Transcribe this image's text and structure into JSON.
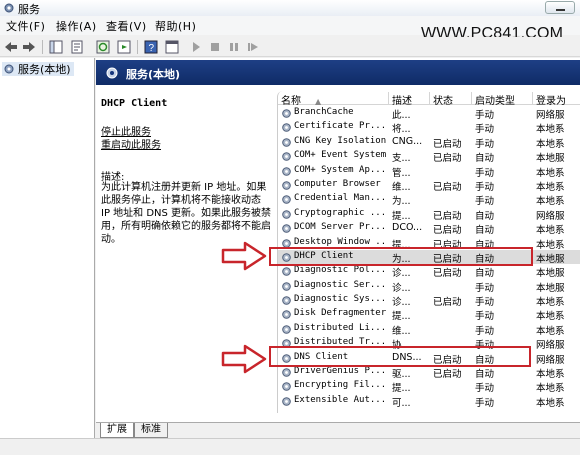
{
  "window": {
    "title": "服务"
  },
  "watermark": "WWW.PC841.COM",
  "menu": [
    {
      "label": "文件(F)"
    },
    {
      "label": "操作(A)"
    },
    {
      "label": "查看(V)"
    },
    {
      "label": "帮助(H)"
    }
  ],
  "toolbar": {
    "icons": [
      "back-icon",
      "forward-icon",
      "show-tree-icon",
      "properties-icon",
      "refresh-icon",
      "export-icon",
      "help-icon",
      "console-icon",
      "start-icon",
      "stop-icon",
      "pause-icon",
      "restart-icon"
    ]
  },
  "tree": {
    "item": "服务(本地)"
  },
  "pane": {
    "title": "服务(本地)"
  },
  "detail": {
    "service_name": "DHCP Client",
    "stop_link": "停止此服务",
    "restart_link": "重启动此服务",
    "desc_label": "描述:",
    "desc_text": "为此计算机注册并更新 IP 地址。如果此服务停止，计算机将不能接收动态 IP 地址和 DNS 更新。如果此服务被禁用，所有明确依赖它的服务都将不能启动。"
  },
  "columns": {
    "name": "名称",
    "desc": "描述",
    "status": "状态",
    "start": "启动类型",
    "logon": "登录为"
  },
  "services": [
    {
      "name": "BranchCache",
      "desc": "此...",
      "status": "",
      "start": "手动",
      "logon": "网络服"
    },
    {
      "name": "Certificate Pr...",
      "desc": "将...",
      "status": "",
      "start": "手动",
      "logon": "本地系"
    },
    {
      "name": "CNG Key Isolation",
      "desc": "CNG...",
      "status": "已启动",
      "start": "手动",
      "logon": "本地系"
    },
    {
      "name": "COM+ Event System",
      "desc": "支...",
      "status": "已启动",
      "start": "自动",
      "logon": "本地服"
    },
    {
      "name": "COM+ System Ap...",
      "desc": "管...",
      "status": "",
      "start": "手动",
      "logon": "本地系"
    },
    {
      "name": "Computer Browser",
      "desc": "维...",
      "status": "已启动",
      "start": "手动",
      "logon": "本地系"
    },
    {
      "name": "Credential Man...",
      "desc": "为...",
      "status": "",
      "start": "手动",
      "logon": "本地系"
    },
    {
      "name": "Cryptographic ...",
      "desc": "提...",
      "status": "已启动",
      "start": "自动",
      "logon": "网络服"
    },
    {
      "name": "DCOM Server Pr...",
      "desc": "DCO...",
      "status": "已启动",
      "start": "自动",
      "logon": "本地系"
    },
    {
      "name": "Desktop Window ...",
      "desc": "提...",
      "status": "已启动",
      "start": "自动",
      "logon": "本地系"
    },
    {
      "name": "DHCP Client",
      "desc": "为...",
      "status": "已启动",
      "start": "自动",
      "logon": "本地服"
    },
    {
      "name": "Diagnostic Pol...",
      "desc": "诊...",
      "status": "已启动",
      "start": "自动",
      "logon": "本地服"
    },
    {
      "name": "Diagnostic Ser...",
      "desc": "诊...",
      "status": "",
      "start": "手动",
      "logon": "本地服"
    },
    {
      "name": "Diagnostic Sys...",
      "desc": "诊...",
      "status": "已启动",
      "start": "手动",
      "logon": "本地系"
    },
    {
      "name": "Disk Defragmenter",
      "desc": "提...",
      "status": "",
      "start": "手动",
      "logon": "本地系"
    },
    {
      "name": "Distributed Li...",
      "desc": "维...",
      "status": "",
      "start": "手动",
      "logon": "本地系"
    },
    {
      "name": "Distributed Tr...",
      "desc": "协...",
      "status": "",
      "start": "手动",
      "logon": "网络服"
    },
    {
      "name": "DNS Client",
      "desc": "DNS...",
      "status": "已启动",
      "start": "自动",
      "logon": "网络服"
    },
    {
      "name": "DriverGenius P...",
      "desc": "驱...",
      "status": "已启动",
      "start": "自动",
      "logon": "本地系"
    },
    {
      "name": "Encrypting Fil...",
      "desc": "提...",
      "status": "",
      "start": "手动",
      "logon": "本地系"
    },
    {
      "name": "Extensible Aut...",
      "desc": "可...",
      "status": "",
      "start": "手动",
      "logon": "本地系"
    }
  ],
  "selected_service": "DHCP Client",
  "tabs": [
    {
      "label": "扩展"
    },
    {
      "label": "标准"
    }
  ],
  "colors": {
    "header_bg": "#14337a",
    "highlight": "#c8252b",
    "selection": "#dcdcdc"
  }
}
